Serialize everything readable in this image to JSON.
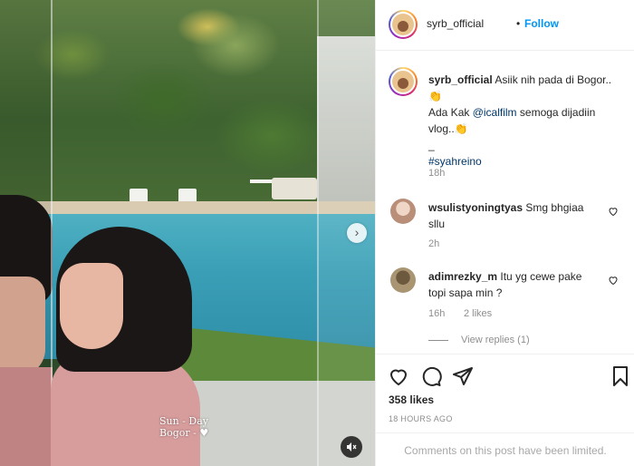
{
  "post": {
    "username": "syrb_official",
    "follow_label": "Follow",
    "separator": "•"
  },
  "caption": {
    "username": "syrb_official",
    "line1": "Asiik nih pada di Bogor..",
    "emoji1": "👏",
    "line2_prefix": "Ada Kak ",
    "mention": "@icalfilm",
    "line2_suffix": " semoga dijadiin vlog..",
    "emoji2": "👏",
    "underscore": "_",
    "hashtag": "#syahreino",
    "time": "18h"
  },
  "comments": [
    {
      "username": "wsulistyoningtyas",
      "text": "Smg bhgiaa sllu",
      "time": "2h"
    },
    {
      "username": "adimrezky_m",
      "text": "Itu yg cewe pake topi sapa min ?",
      "time": "16h",
      "likes": "2 likes"
    }
  ],
  "view_replies": "View replies (1)",
  "likes_count": "358 likes",
  "posted_ago": "18 HOURS AGO",
  "comments_limited": "Comments on this post have been limited.",
  "video": {
    "sticker_line1": "Sun - Day",
    "sticker_line2": "Bogor - ♥"
  },
  "icons": {
    "next": "chevron-right-icon",
    "audio": "speaker-muted-icon",
    "like": "heart-icon",
    "comment": "comment-icon",
    "share": "paper-plane-icon",
    "save": "bookmark-icon"
  },
  "colors": {
    "follow_blue": "#0095f6",
    "link_blue": "#00376b",
    "meta_gray": "#8e8e8e"
  }
}
